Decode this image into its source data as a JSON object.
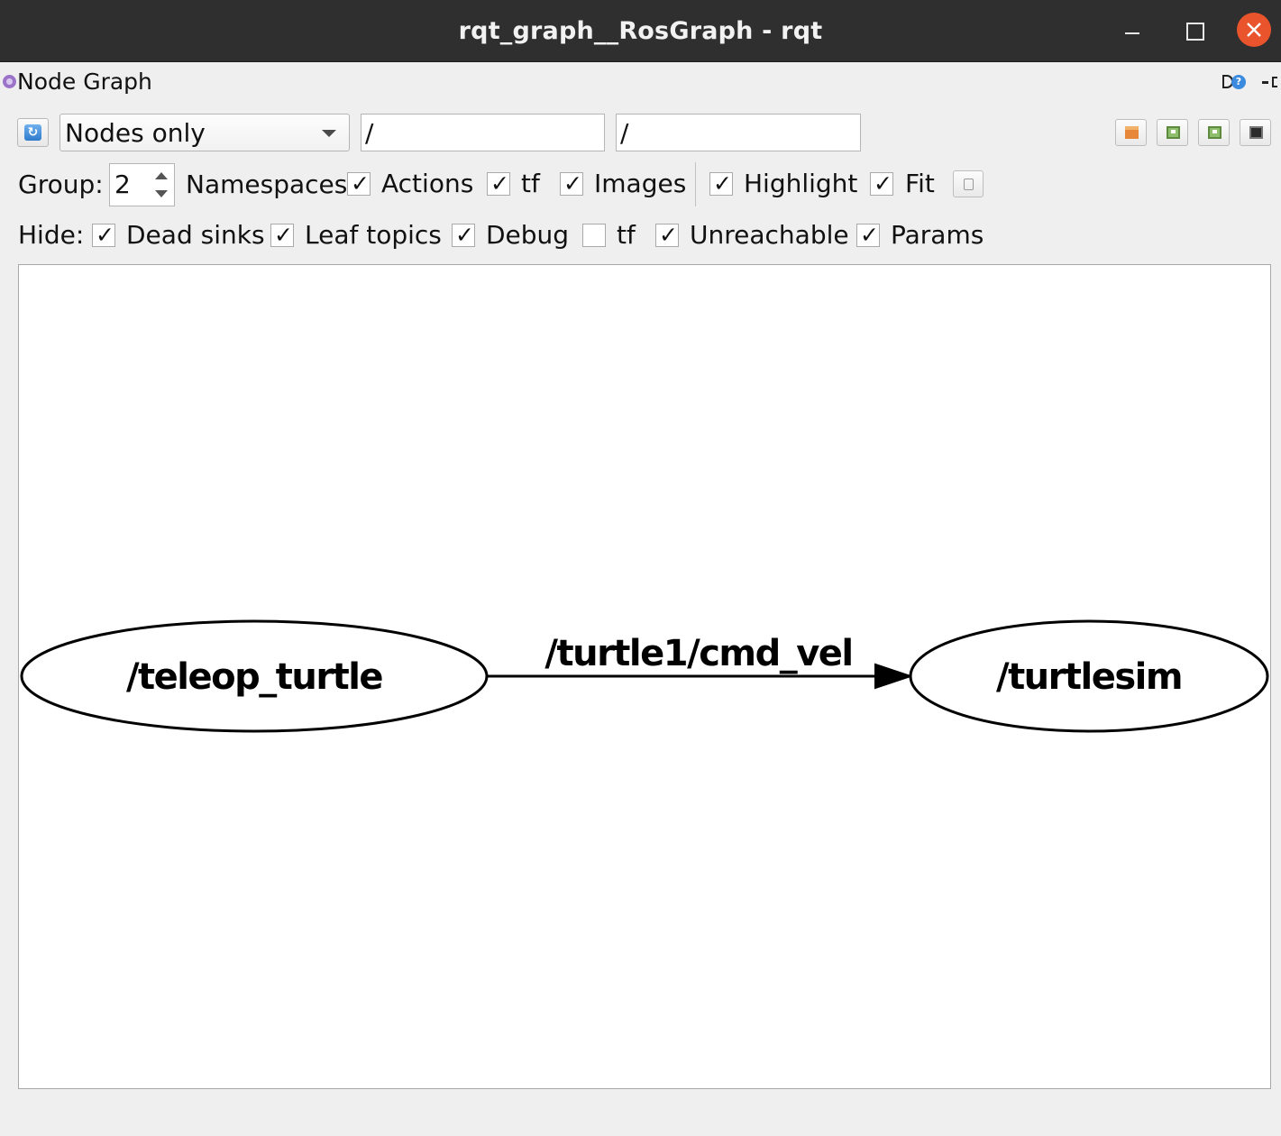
{
  "window": {
    "title": "rqt_graph__RosGraph - rqt"
  },
  "dock": {
    "title": "Node Graph",
    "help_glyph": "?"
  },
  "toolbar": {
    "refresh_glyph": "↻",
    "mode": "Nodes only",
    "node_filter": "/",
    "topic_filter": "/"
  },
  "options": {
    "group_label": "Group:",
    "group_value": "2",
    "namespaces": {
      "label": "Namespaces",
      "checked": true
    },
    "actions": {
      "label": "Actions",
      "checked": true
    },
    "tf": {
      "label": "tf",
      "checked": true
    },
    "images": {
      "label": "Images",
      "checked": true
    },
    "highlight": {
      "label": "Highlight",
      "checked": true
    },
    "fit": {
      "label": "Fit",
      "checked": true
    }
  },
  "hide": {
    "label": "Hide:",
    "dead_sinks": {
      "label": "Dead sinks",
      "checked": true
    },
    "leaf_topics": {
      "label": "Leaf topics",
      "checked": true
    },
    "debug": {
      "label": "Debug",
      "checked": true
    },
    "tf": {
      "label": "tf",
      "checked": false
    },
    "unreachable": {
      "label": "Unreachable",
      "checked": true
    },
    "params": {
      "label": "Params",
      "checked": true
    }
  },
  "graph": {
    "nodes": [
      {
        "id": "teleop",
        "label": "/teleop_turtle"
      },
      {
        "id": "turtlesim",
        "label": "/turtlesim"
      }
    ],
    "edges": [
      {
        "from": "teleop",
        "to": "turtlesim",
        "label": "/turtle1/cmd_vel"
      }
    ]
  }
}
